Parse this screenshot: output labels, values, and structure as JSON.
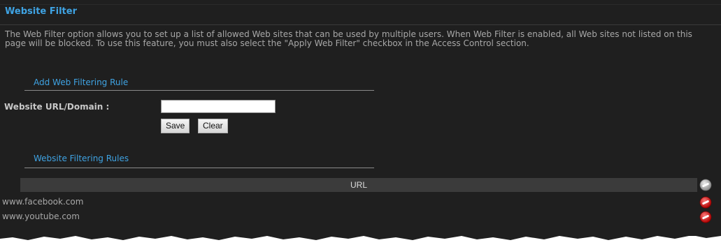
{
  "page": {
    "title": "Website Filter",
    "description": "The Web Filter option allows you to set up a list of allowed Web sites that can be used by multiple users. When Web Filter is enabled, all Web sites not listed on this page will be blocked. To use this feature, you must also select the \"Apply Web Filter\" checkbox in the Access Control section."
  },
  "add_rule": {
    "heading": "Add Web Filtering Rule",
    "url_label": "Website URL/Domain :",
    "url_value": "",
    "save_label": "Save",
    "clear_label": "Clear"
  },
  "rules": {
    "heading": "Website Filtering Rules",
    "column_header": "URL",
    "header_icon": "disabled-delete-icon",
    "rows": [
      {
        "url": "www.facebook.com",
        "icon": "delete-icon"
      },
      {
        "url": "www.youtube.com",
        "icon": "delete-icon"
      }
    ]
  },
  "colors": {
    "background": "#1f1f1f",
    "accent": "#3fa3e3",
    "text": "#a8a8a8",
    "delete": "#d42020"
  }
}
